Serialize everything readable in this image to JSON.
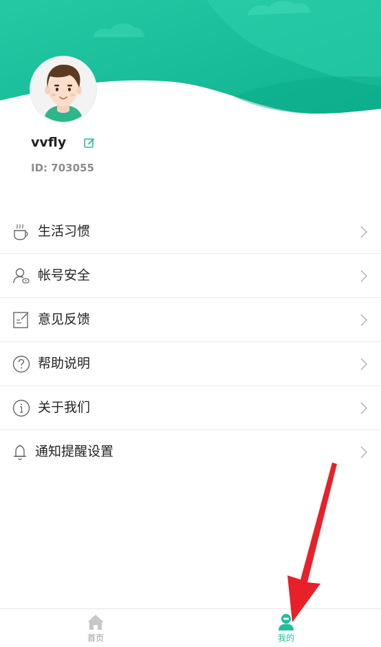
{
  "profile": {
    "username": "vvfly",
    "id_text": "ID: 703055"
  },
  "menu": [
    {
      "label": "生活习惯",
      "icon": "coffee-cup-icon"
    },
    {
      "label": "帐号安全",
      "icon": "user-security-icon"
    },
    {
      "label": "意见反馈",
      "icon": "feedback-edit-icon"
    },
    {
      "label": "帮助说明",
      "icon": "question-circle-icon"
    },
    {
      "label": "关于我们",
      "icon": "info-circle-icon"
    },
    {
      "label": "通知提醒设置",
      "icon": "bell-icon"
    }
  ],
  "tabbar": {
    "home_label": "首页",
    "mine_label": "我的",
    "active": "mine"
  },
  "colors": {
    "brand": "#1fbf9a",
    "header_gradient_start": "#22c5a0",
    "header_gradient_end": "#0fb491",
    "annotation_arrow": "#e8202a"
  }
}
